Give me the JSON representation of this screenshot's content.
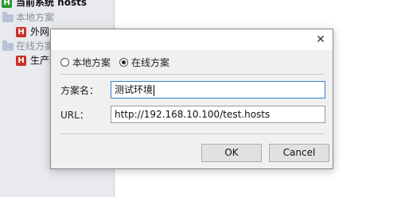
{
  "sidebar": {
    "items": [
      {
        "label": "当前系统 hosts",
        "badge": "H",
        "icon": "hosts-green-icon"
      },
      {
        "label": "本地方案",
        "icon": "folder-icon"
      },
      {
        "label": "外网",
        "badge": "H",
        "icon": "hosts-red-icon"
      },
      {
        "label": "在线方案",
        "icon": "folder-icon"
      },
      {
        "label": "生产环",
        "badge": "H",
        "icon": "hosts-red-icon"
      }
    ]
  },
  "dialog": {
    "close_glyph": "✕",
    "scheme_type": {
      "options": [
        "本地方案",
        "在线方案"
      ],
      "selected": "在线方案"
    },
    "name_field": {
      "label": "方案名：",
      "value": "测试环境"
    },
    "url_field": {
      "label": "URL：",
      "value": "http://192.168.10.100/test.hosts"
    },
    "ok_label": "OK",
    "cancel_label": "Cancel"
  },
  "colors": {
    "accent": "#3c7fd1",
    "hosts_green": "#2e9a2e",
    "hosts_red": "#c8312b"
  }
}
